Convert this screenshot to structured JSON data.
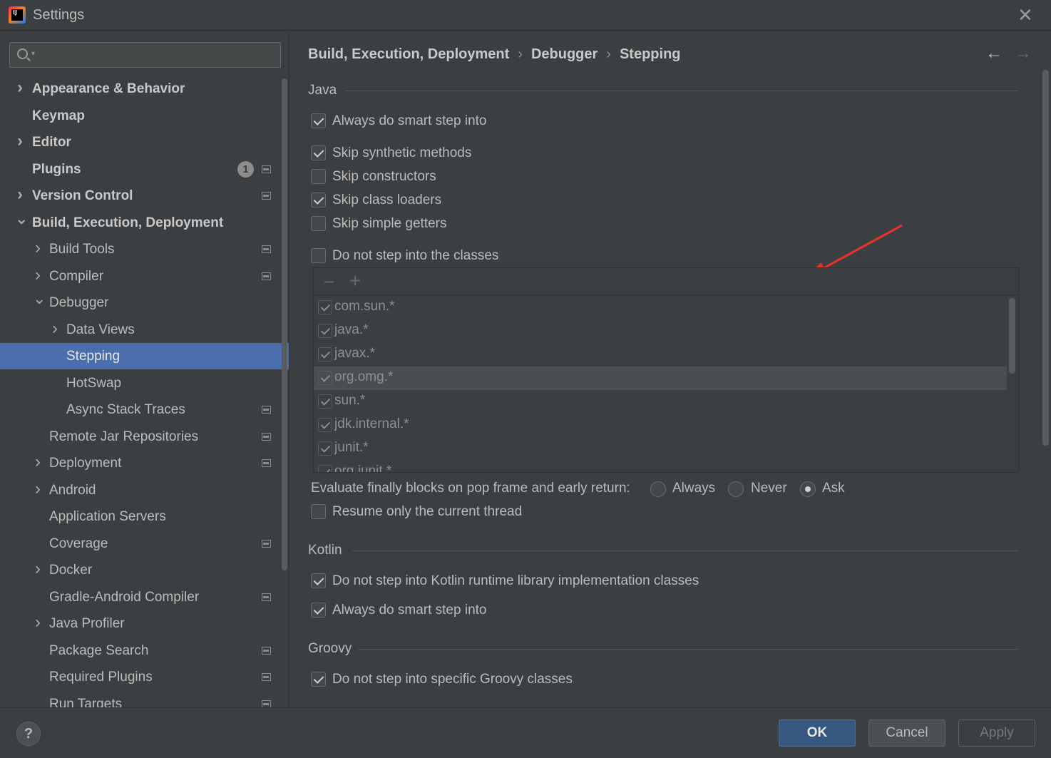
{
  "window": {
    "title": "Settings",
    "app_icon": "intellij-idea-icon"
  },
  "search": {
    "placeholder": "",
    "value": ""
  },
  "sidebar": {
    "items": [
      {
        "label": "Appearance & Behavior",
        "level": 0,
        "expander": "collapsed",
        "bold": true
      },
      {
        "label": "Keymap",
        "level": 0,
        "expander": "none",
        "bold": true
      },
      {
        "label": "Editor",
        "level": 0,
        "expander": "collapsed",
        "bold": true
      },
      {
        "label": "Plugins",
        "level": 0,
        "expander": "none",
        "bold": true,
        "badge": "1",
        "project_icon": true
      },
      {
        "label": "Version Control",
        "level": 0,
        "expander": "collapsed",
        "bold": true,
        "project_icon": true
      },
      {
        "label": "Build, Execution, Deployment",
        "level": 0,
        "expander": "expanded",
        "bold": true
      },
      {
        "label": "Build Tools",
        "level": 1,
        "expander": "collapsed",
        "project_icon": true
      },
      {
        "label": "Compiler",
        "level": 1,
        "expander": "collapsed",
        "project_icon": true
      },
      {
        "label": "Debugger",
        "level": 1,
        "expander": "expanded"
      },
      {
        "label": "Data Views",
        "level": 2,
        "expander": "collapsed"
      },
      {
        "label": "Stepping",
        "level": 2,
        "expander": "none",
        "selected": true
      },
      {
        "label": "HotSwap",
        "level": 2,
        "expander": "none"
      },
      {
        "label": "Async Stack Traces",
        "level": 2,
        "expander": "none",
        "project_icon": true
      },
      {
        "label": "Remote Jar Repositories",
        "level": 1,
        "expander": "none",
        "project_icon": true
      },
      {
        "label": "Deployment",
        "level": 1,
        "expander": "collapsed",
        "project_icon": true
      },
      {
        "label": "Android",
        "level": 1,
        "expander": "collapsed"
      },
      {
        "label": "Application Servers",
        "level": 1,
        "expander": "none"
      },
      {
        "label": "Coverage",
        "level": 1,
        "expander": "none",
        "project_icon": true
      },
      {
        "label": "Docker",
        "level": 1,
        "expander": "collapsed"
      },
      {
        "label": "Gradle-Android Compiler",
        "level": 1,
        "expander": "none",
        "project_icon": true
      },
      {
        "label": "Java Profiler",
        "level": 1,
        "expander": "collapsed"
      },
      {
        "label": "Package Search",
        "level": 1,
        "expander": "none",
        "project_icon": true
      },
      {
        "label": "Required Plugins",
        "level": 1,
        "expander": "none",
        "project_icon": true
      },
      {
        "label": "Run Targets",
        "level": 1,
        "expander": "none",
        "project_icon": true
      }
    ]
  },
  "breadcrumb": [
    "Build, Execution, Deployment",
    "Debugger",
    "Stepping"
  ],
  "java": {
    "title": "Java",
    "always_smart_step": {
      "label": "Always do smart step into",
      "checked": true
    },
    "skip_synthetic": {
      "label": "Skip synthetic methods",
      "checked": true
    },
    "skip_constructors": {
      "label": "Skip constructors",
      "checked": false
    },
    "skip_class_loaders": {
      "label": "Skip class loaders",
      "checked": true
    },
    "skip_simple_getters": {
      "label": "Skip simple getters",
      "checked": false
    },
    "do_not_step_classes": {
      "label": "Do not step into the classes",
      "checked": false
    },
    "class_filters": [
      "com.sun.*",
      "java.*",
      "javax.*",
      "org.omg.*",
      "sun.*",
      "jdk.internal.*",
      "junit.*",
      "org.junit.*"
    ],
    "evaluate_finally": {
      "label": "Evaluate finally blocks on pop frame and early return:",
      "options": [
        "Always",
        "Never",
        "Ask"
      ],
      "selected": "Ask"
    },
    "resume_current_thread": {
      "label": "Resume only the current thread",
      "checked": false
    }
  },
  "kotlin": {
    "title": "Kotlin",
    "no_runtime_step": {
      "label": "Do not step into Kotlin runtime library implementation classes",
      "checked": true
    },
    "always_smart_step": {
      "label": "Always do smart step into",
      "checked": true
    }
  },
  "groovy": {
    "title": "Groovy",
    "no_specific_step": {
      "label": "Do not step into specific Groovy classes",
      "checked": true
    }
  },
  "buttons": {
    "help": "?",
    "ok": "OK",
    "cancel": "Cancel",
    "apply": "Apply"
  },
  "colors": {
    "background": "#3c3f41",
    "selection": "#4b6eaf",
    "ok_button": "#365880",
    "annotation_arrow": "#e8322a"
  }
}
